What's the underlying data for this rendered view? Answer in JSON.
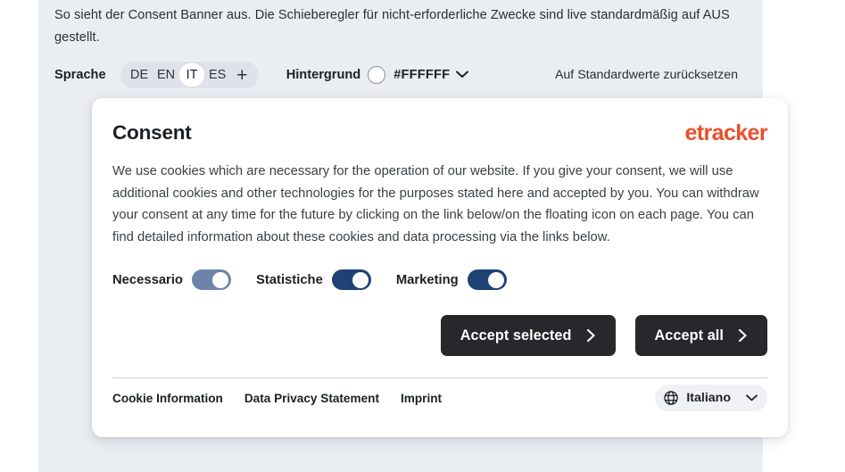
{
  "intro": {
    "text": "So sieht der Consent Banner aus. Die Schieberegler für nicht-erforderliche Zwecke sind live standardmäßig auf AUS gestellt."
  },
  "controls": {
    "language_label": "Sprache",
    "languages": [
      "DE",
      "EN",
      "IT",
      "ES"
    ],
    "selected_language": "IT",
    "add_language_icon": "plus-icon",
    "background_label": "Hintergrund",
    "background_color": "#FFFFFF",
    "background_swatch_icon": "color-swatch-circle-icon",
    "background_chevron_icon": "chevron-down-icon",
    "reset_label": "Auf Standardwerte zurücksetzen"
  },
  "banner": {
    "title": "Consent",
    "brand": "etracker",
    "brand_color": "#e8502a",
    "body": "We use cookies which are necessary for the operation of our website. If you give your consent, we will use additional cookies and other technologies for the purposes stated here and accepted by you. You can withdraw your consent at any time for the future by clicking on the link below/on the floating icon on each page. You can find detailed information about these cookies and data processing via the links below.",
    "purposes": [
      {
        "label": "Necessario",
        "state": "on",
        "locked": true,
        "color": "#6b84a8"
      },
      {
        "label": "Statistiche",
        "state": "on",
        "locked": false,
        "color": "#1d4273"
      },
      {
        "label": "Marketing",
        "state": "on",
        "locked": false,
        "color": "#1d4273"
      }
    ],
    "buttons": {
      "accept_selected": "Accept selected",
      "accept_all": "Accept all",
      "chevron_icon": "chevron-right-icon",
      "color": "#26282b"
    },
    "footer": {
      "links": [
        "Cookie Information",
        "Data Privacy Statement",
        "Imprint"
      ],
      "language_selected": "Italiano",
      "globe_icon": "globe-icon",
      "chevron_icon": "chevron-down-icon"
    }
  }
}
